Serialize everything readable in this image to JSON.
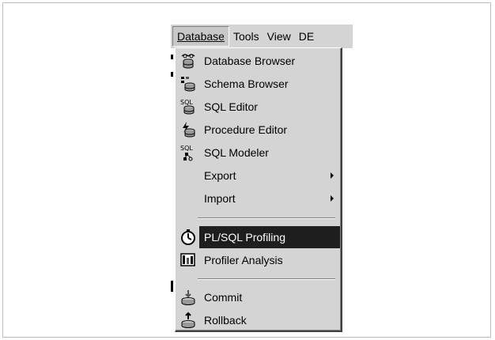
{
  "menubar": {
    "items": [
      {
        "label": "Database",
        "active": true
      },
      {
        "label": "Tools"
      },
      {
        "label": "View"
      },
      {
        "label": "DE"
      }
    ]
  },
  "menu": {
    "items": [
      {
        "label": "Database Browser",
        "icon": "database-browser-icon"
      },
      {
        "label": "Schema Browser",
        "icon": "schema-browser-icon"
      },
      {
        "label": "SQL Editor",
        "icon": "sql-editor-icon"
      },
      {
        "label": "Procedure Editor",
        "icon": "procedure-editor-icon"
      },
      {
        "label": "SQL Modeler",
        "icon": "sql-modeler-icon"
      },
      {
        "label": "Export",
        "submenu": true
      },
      {
        "label": "Import",
        "submenu": true
      },
      {
        "label": "PL/SQL Profiling",
        "icon": "stopwatch-icon",
        "highlighted": true
      },
      {
        "label": "Profiler Analysis",
        "icon": "profiler-analysis-icon"
      },
      {
        "label": "Commit",
        "icon": "commit-icon"
      },
      {
        "label": "Rollback",
        "icon": "rollback-icon"
      }
    ]
  },
  "colors": {
    "menu_bg": "#d4d4d4",
    "highlight_bg": "#1e1e1e",
    "highlight_text": "#ffffff"
  }
}
